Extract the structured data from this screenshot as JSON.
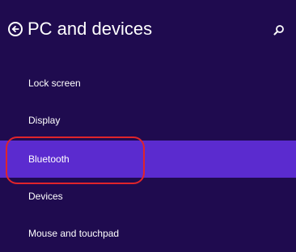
{
  "header": {
    "title": "PC and devices",
    "back_icon": "back-arrow-circle-icon",
    "search_icon": "search-icon"
  },
  "nav": {
    "items": [
      {
        "label": "Lock screen",
        "selected": false
      },
      {
        "label": "Display",
        "selected": false
      },
      {
        "label": "Bluetooth",
        "selected": true
      },
      {
        "label": "Devices",
        "selected": false
      },
      {
        "label": "Mouse and touchpad",
        "selected": false
      }
    ]
  },
  "colors": {
    "background": "#1f0b4f",
    "selected": "#5b2bcf",
    "annotation_ring": "#e0242b",
    "text": "#ffffff"
  }
}
